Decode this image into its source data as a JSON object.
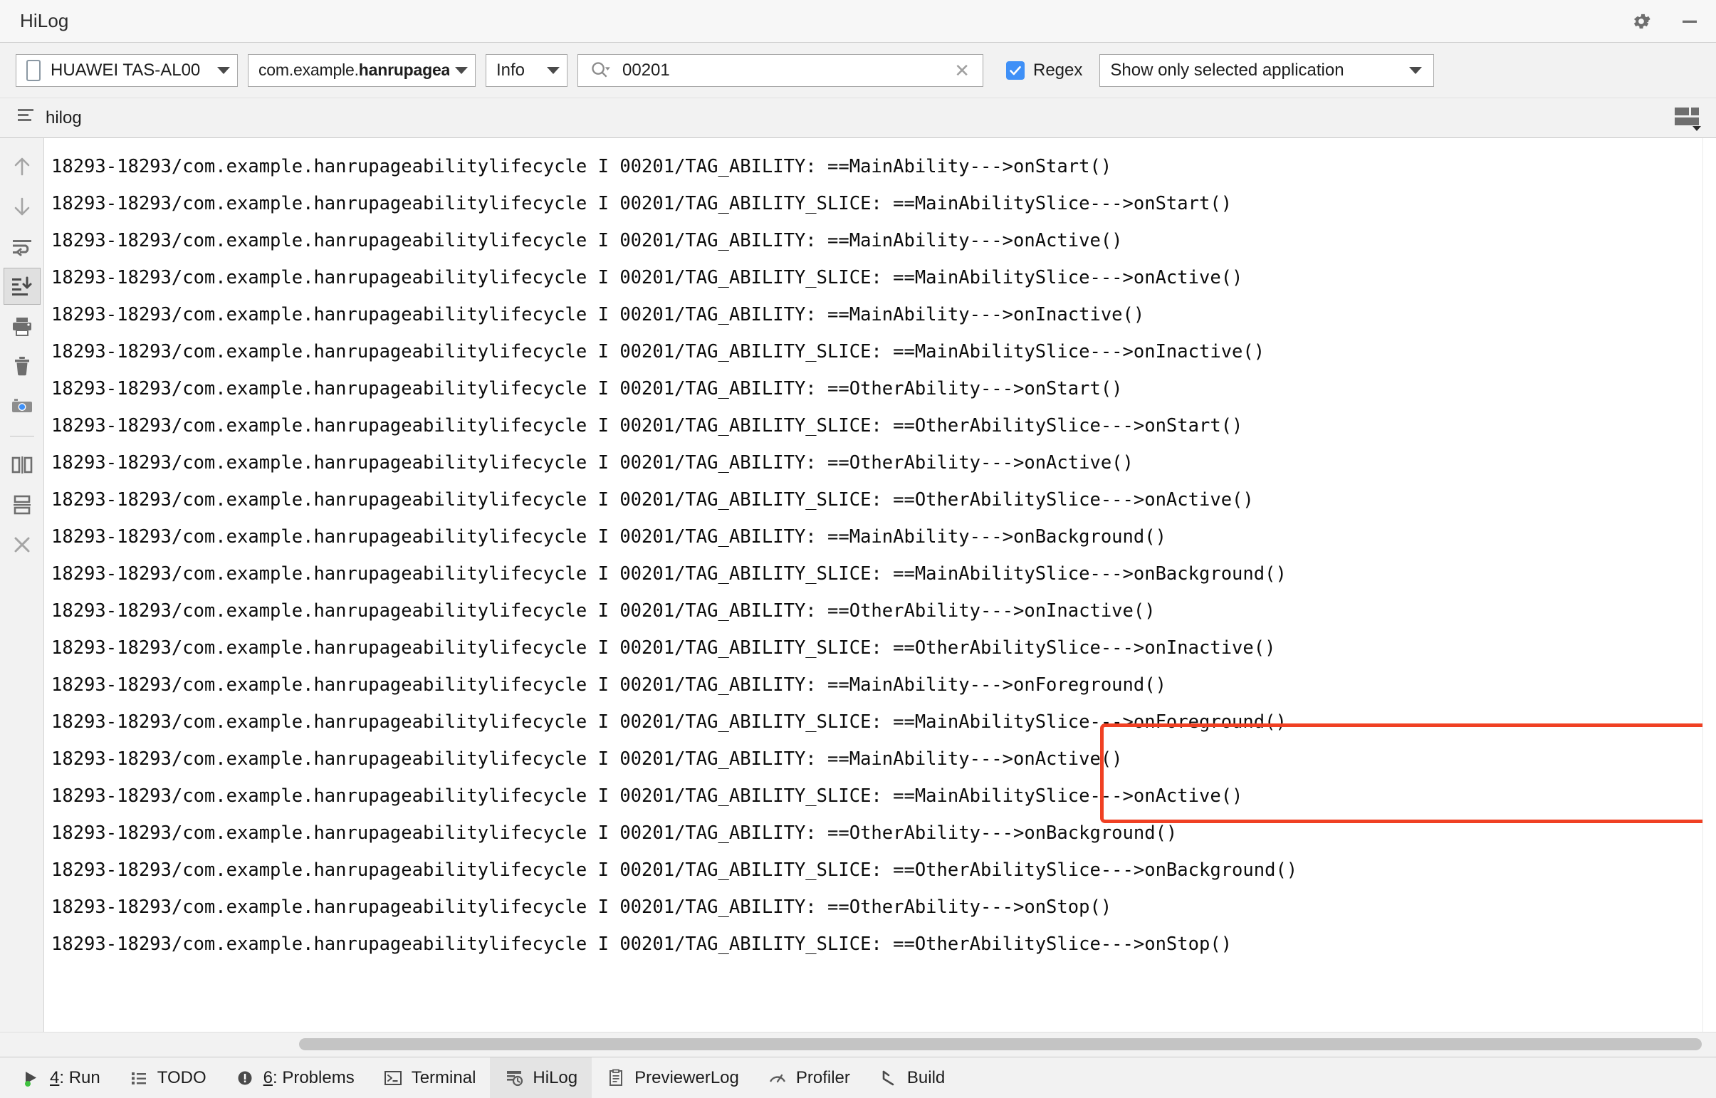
{
  "window": {
    "title": "HiLog",
    "settings_icon": "gear-icon",
    "minimize_icon": "minimize-icon"
  },
  "toolbar": {
    "device": {
      "label": "HUAWEI TAS-AL00",
      "icon": "phone-icon"
    },
    "package": {
      "prefix": "com.example.",
      "bold": "hanrupageabilitylif"
    },
    "level": {
      "label": "Info"
    },
    "search": {
      "value": "00201",
      "placeholder": "",
      "icon": "search-icon",
      "clear_icon": "close-icon"
    },
    "regex": {
      "label": "Regex",
      "checked": true
    },
    "scope": {
      "label": "Show only selected application"
    }
  },
  "tabstrip": {
    "tab_label": "hilog",
    "tab_icon": "log-lines-icon",
    "layout_icon": "layout-columns-icon"
  },
  "rail": {
    "items": [
      {
        "name": "scroll-up-icon",
        "selected": false
      },
      {
        "name": "scroll-down-icon",
        "selected": false
      },
      {
        "name": "soft-wrap-icon",
        "selected": false
      },
      {
        "name": "scroll-to-end-icon",
        "selected": true
      },
      {
        "name": "print-icon",
        "selected": false
      },
      {
        "name": "clear-all-icon",
        "selected": false
      },
      {
        "name": "screenshot-camera-icon",
        "selected": false
      },
      {
        "name": "split-vertically-icon",
        "selected": false
      },
      {
        "name": "split-horizontally-icon",
        "selected": false
      },
      {
        "name": "close-icon",
        "selected": false
      }
    ]
  },
  "log": {
    "lines": [
      "18293-18293/com.example.hanrupageabilitylifecycle I 00201/TAG_ABILITY: ==MainAbility--->onStart()",
      "18293-18293/com.example.hanrupageabilitylifecycle I 00201/TAG_ABILITY_SLICE: ==MainAbilitySlice--->onStart()",
      "18293-18293/com.example.hanrupageabilitylifecycle I 00201/TAG_ABILITY: ==MainAbility--->onActive()",
      "18293-18293/com.example.hanrupageabilitylifecycle I 00201/TAG_ABILITY_SLICE: ==MainAbilitySlice--->onActive()",
      "18293-18293/com.example.hanrupageabilitylifecycle I 00201/TAG_ABILITY: ==MainAbility--->onInactive()",
      "18293-18293/com.example.hanrupageabilitylifecycle I 00201/TAG_ABILITY_SLICE: ==MainAbilitySlice--->onInactive()",
      "18293-18293/com.example.hanrupageabilitylifecycle I 00201/TAG_ABILITY: ==OtherAbility--->onStart()",
      "18293-18293/com.example.hanrupageabilitylifecycle I 00201/TAG_ABILITY_SLICE: ==OtherAbilitySlice--->onStart()",
      "18293-18293/com.example.hanrupageabilitylifecycle I 00201/TAG_ABILITY: ==OtherAbility--->onActive()",
      "18293-18293/com.example.hanrupageabilitylifecycle I 00201/TAG_ABILITY_SLICE: ==OtherAbilitySlice--->onActive()",
      "18293-18293/com.example.hanrupageabilitylifecycle I 00201/TAG_ABILITY: ==MainAbility--->onBackground()",
      "18293-18293/com.example.hanrupageabilitylifecycle I 00201/TAG_ABILITY_SLICE: ==MainAbilitySlice--->onBackground()",
      "18293-18293/com.example.hanrupageabilitylifecycle I 00201/TAG_ABILITY: ==OtherAbility--->onInactive()",
      "18293-18293/com.example.hanrupageabilitylifecycle I 00201/TAG_ABILITY_SLICE: ==OtherAbilitySlice--->onInactive()",
      "18293-18293/com.example.hanrupageabilitylifecycle I 00201/TAG_ABILITY: ==MainAbility--->onForeground()",
      "18293-18293/com.example.hanrupageabilitylifecycle I 00201/TAG_ABILITY_SLICE: ==MainAbilitySlice--->onForeground()",
      "18293-18293/com.example.hanrupageabilitylifecycle I 00201/TAG_ABILITY: ==MainAbility--->onActive()",
      "18293-18293/com.example.hanrupageabilitylifecycle I 00201/TAG_ABILITY_SLICE: ==MainAbilitySlice--->onActive()",
      "18293-18293/com.example.hanrupageabilitylifecycle I 00201/TAG_ABILITY: ==OtherAbility--->onBackground()",
      "18293-18293/com.example.hanrupageabilitylifecycle I 00201/TAG_ABILITY_SLICE: ==OtherAbilitySlice--->onBackground()",
      "18293-18293/com.example.hanrupageabilitylifecycle I 00201/TAG_ABILITY: ==OtherAbility--->onStop()",
      "18293-18293/com.example.hanrupageabilitylifecycle I 00201/TAG_ABILITY_SLICE: ==OtherAbilitySlice--->onStop()"
    ],
    "annotation": {
      "type": "red-rectangle",
      "color": "#f04023"
    }
  },
  "statusbar": {
    "items": [
      {
        "icon": "run-icon",
        "key": "4",
        "label": ": Run",
        "active": false
      },
      {
        "icon": "todo-icon",
        "key": "",
        "label": "TODO",
        "active": false
      },
      {
        "icon": "problems-icon",
        "key": "6",
        "label": ": Problems",
        "active": false
      },
      {
        "icon": "terminal-icon",
        "key": "",
        "label": "Terminal",
        "active": false
      },
      {
        "icon": "hilog-icon",
        "key": "",
        "label": "HiLog",
        "active": true
      },
      {
        "icon": "previewerlog-icon",
        "key": "",
        "label": "PreviewerLog",
        "active": false
      },
      {
        "icon": "profiler-icon",
        "key": "",
        "label": "Profiler",
        "active": false
      },
      {
        "icon": "build-icon",
        "key": "",
        "label": "Build",
        "active": false
      }
    ]
  },
  "colors": {
    "accent": "#3f90f7",
    "annotation": "#f04023",
    "chrome": "#f2f2f2"
  }
}
